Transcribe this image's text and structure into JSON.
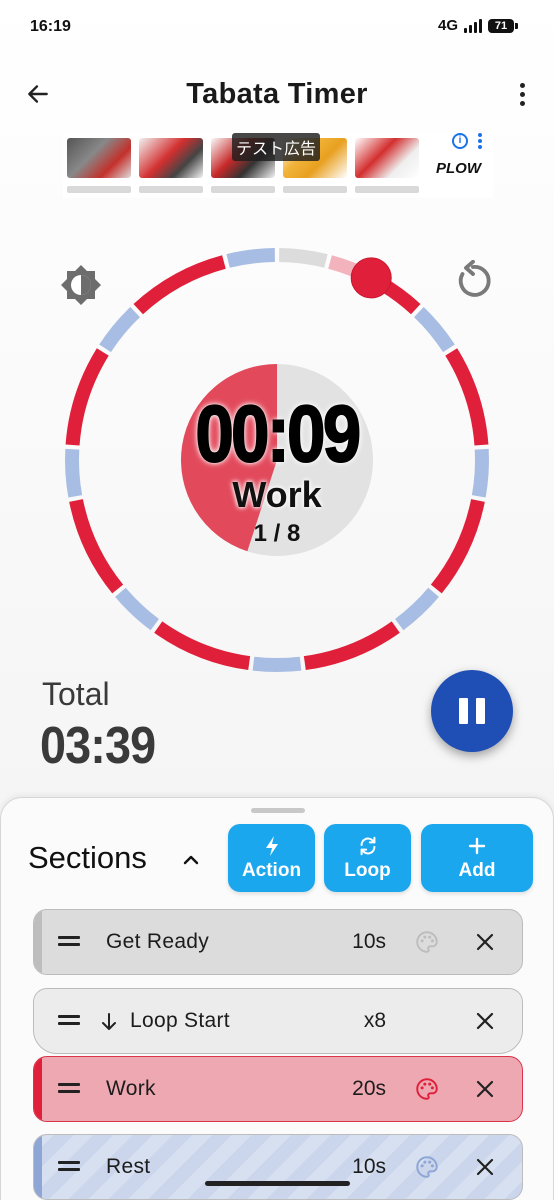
{
  "status_bar": {
    "time": "16:19",
    "network": "4G",
    "battery": "71"
  },
  "app_bar": {
    "title": "Tabata Timer",
    "back_icon": "arrow-left-icon",
    "menu_icon": "more-vertical-icon"
  },
  "ad": {
    "label": "テスト広告",
    "brand_text": "PLOW",
    "info_icon": "info-icon"
  },
  "timer": {
    "time": "00:09",
    "phase": "Work",
    "round": "1 / 8",
    "phase_progress": 0.45,
    "brightness_icon": "brightness-icon",
    "reset_icon": "reset-icon",
    "colors": {
      "work": "#e0203a",
      "rest": "#a8bde3",
      "ready": "#dcdcdc",
      "work_light": "#f2b3bd"
    }
  },
  "total": {
    "label": "Total",
    "value": "03:39"
  },
  "controls": {
    "pause_icon": "pause-icon"
  },
  "sections": {
    "title": "Sections",
    "collapse_icon": "chevron-up-icon",
    "buttons": [
      {
        "label": "Action",
        "icon": "lightning-icon"
      },
      {
        "label": "Loop",
        "icon": "loop-icon"
      },
      {
        "label": "Add",
        "icon": "plus-icon"
      }
    ],
    "items": [
      {
        "label": "Get Ready",
        "value": "10s",
        "color": "#dcdcdc",
        "palette_color": "#bdbdbd",
        "icon": ""
      },
      {
        "label": "Loop Start",
        "value": "x8",
        "color": "#ececec",
        "palette_color": "",
        "icon": "arrow-down-icon"
      },
      {
        "label": "Work",
        "value": "20s",
        "color": "#eda8b2",
        "palette_color": "#e0203a",
        "icon": ""
      },
      {
        "label": "Rest",
        "value": "10s",
        "color": "#d2dcee",
        "palette_color": "#8ea6d6",
        "icon": ""
      }
    ]
  }
}
